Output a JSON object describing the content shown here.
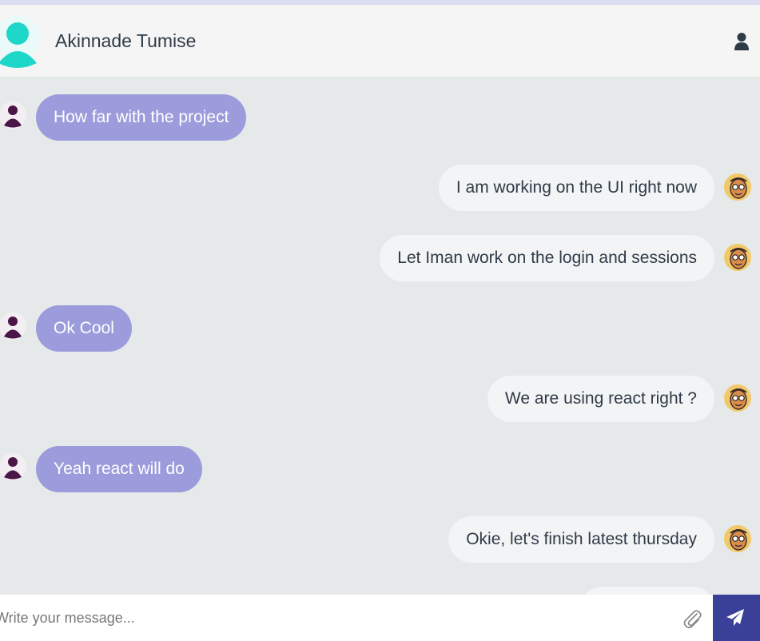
{
  "header": {
    "contact_name": "Akinnade Tumise",
    "avatar_color": "#1fd7c8",
    "user_icon": "user-icon"
  },
  "colors": {
    "received_bubble": "#9c9cdc",
    "sent_bubble": "#f3f4f5",
    "send_button": "#3a3f97",
    "background": "#e6e9ea"
  },
  "messages": [
    {
      "direction": "received",
      "text": "How far with the project"
    },
    {
      "direction": "sent",
      "text": "I am working on the UI right now"
    },
    {
      "direction": "sent",
      "text": "Let Iman work on the login and sessions"
    },
    {
      "direction": "received",
      "text": "Ok Cool"
    },
    {
      "direction": "sent",
      "text": "We are using react right ?"
    },
    {
      "direction": "received",
      "text": "Yeah react will do"
    },
    {
      "direction": "sent",
      "text": "Okie, let's finish latest thursday"
    }
  ],
  "composer": {
    "placeholder": "Write your message...",
    "value": "",
    "attach_icon": "paperclip-icon",
    "send_icon": "paper-plane-icon"
  }
}
